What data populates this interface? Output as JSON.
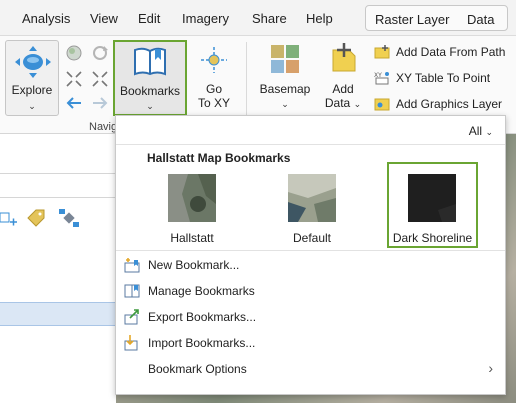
{
  "menubar": {
    "items": [
      "Analysis",
      "View",
      "Edit",
      "Imagery",
      "Share",
      "Help"
    ],
    "context_tabs": [
      "Raster Layer",
      "Data"
    ]
  },
  "ribbon": {
    "explore_label": "Explore",
    "bookmarks_label": "Bookmarks",
    "goto_label_line1": "Go",
    "goto_label_line2": "To XY",
    "basemap_label": "Basemap",
    "adddata_label_line1": "Add",
    "adddata_label_line2": "Data",
    "layer_commands": [
      "Add Data From Path",
      "XY Table To Point",
      "Add Graphics Layer"
    ],
    "group_label_partial": "Navig"
  },
  "dropdown": {
    "filter_value": "All",
    "title": "Hallstatt Map Bookmarks",
    "bookmarks": [
      {
        "label": "Hallstatt",
        "selected": false
      },
      {
        "label": "Default",
        "selected": false
      },
      {
        "label": "Dark Shoreline",
        "selected": true
      }
    ],
    "menu_items": [
      {
        "label": "New Bookmark...",
        "icon": "new-bookmark-icon"
      },
      {
        "label": "Manage Bookmarks",
        "icon": "manage-bookmarks-icon"
      },
      {
        "label": "Export Bookmarks...",
        "icon": "export-bookmarks-icon"
      },
      {
        "label": "Import Bookmarks...",
        "icon": "import-bookmarks-icon"
      },
      {
        "label": "Bookmark Options",
        "icon": "",
        "submenu": true
      }
    ]
  },
  "colors": {
    "selection_green": "#6aa532",
    "accent_blue": "#3a8fd6"
  }
}
